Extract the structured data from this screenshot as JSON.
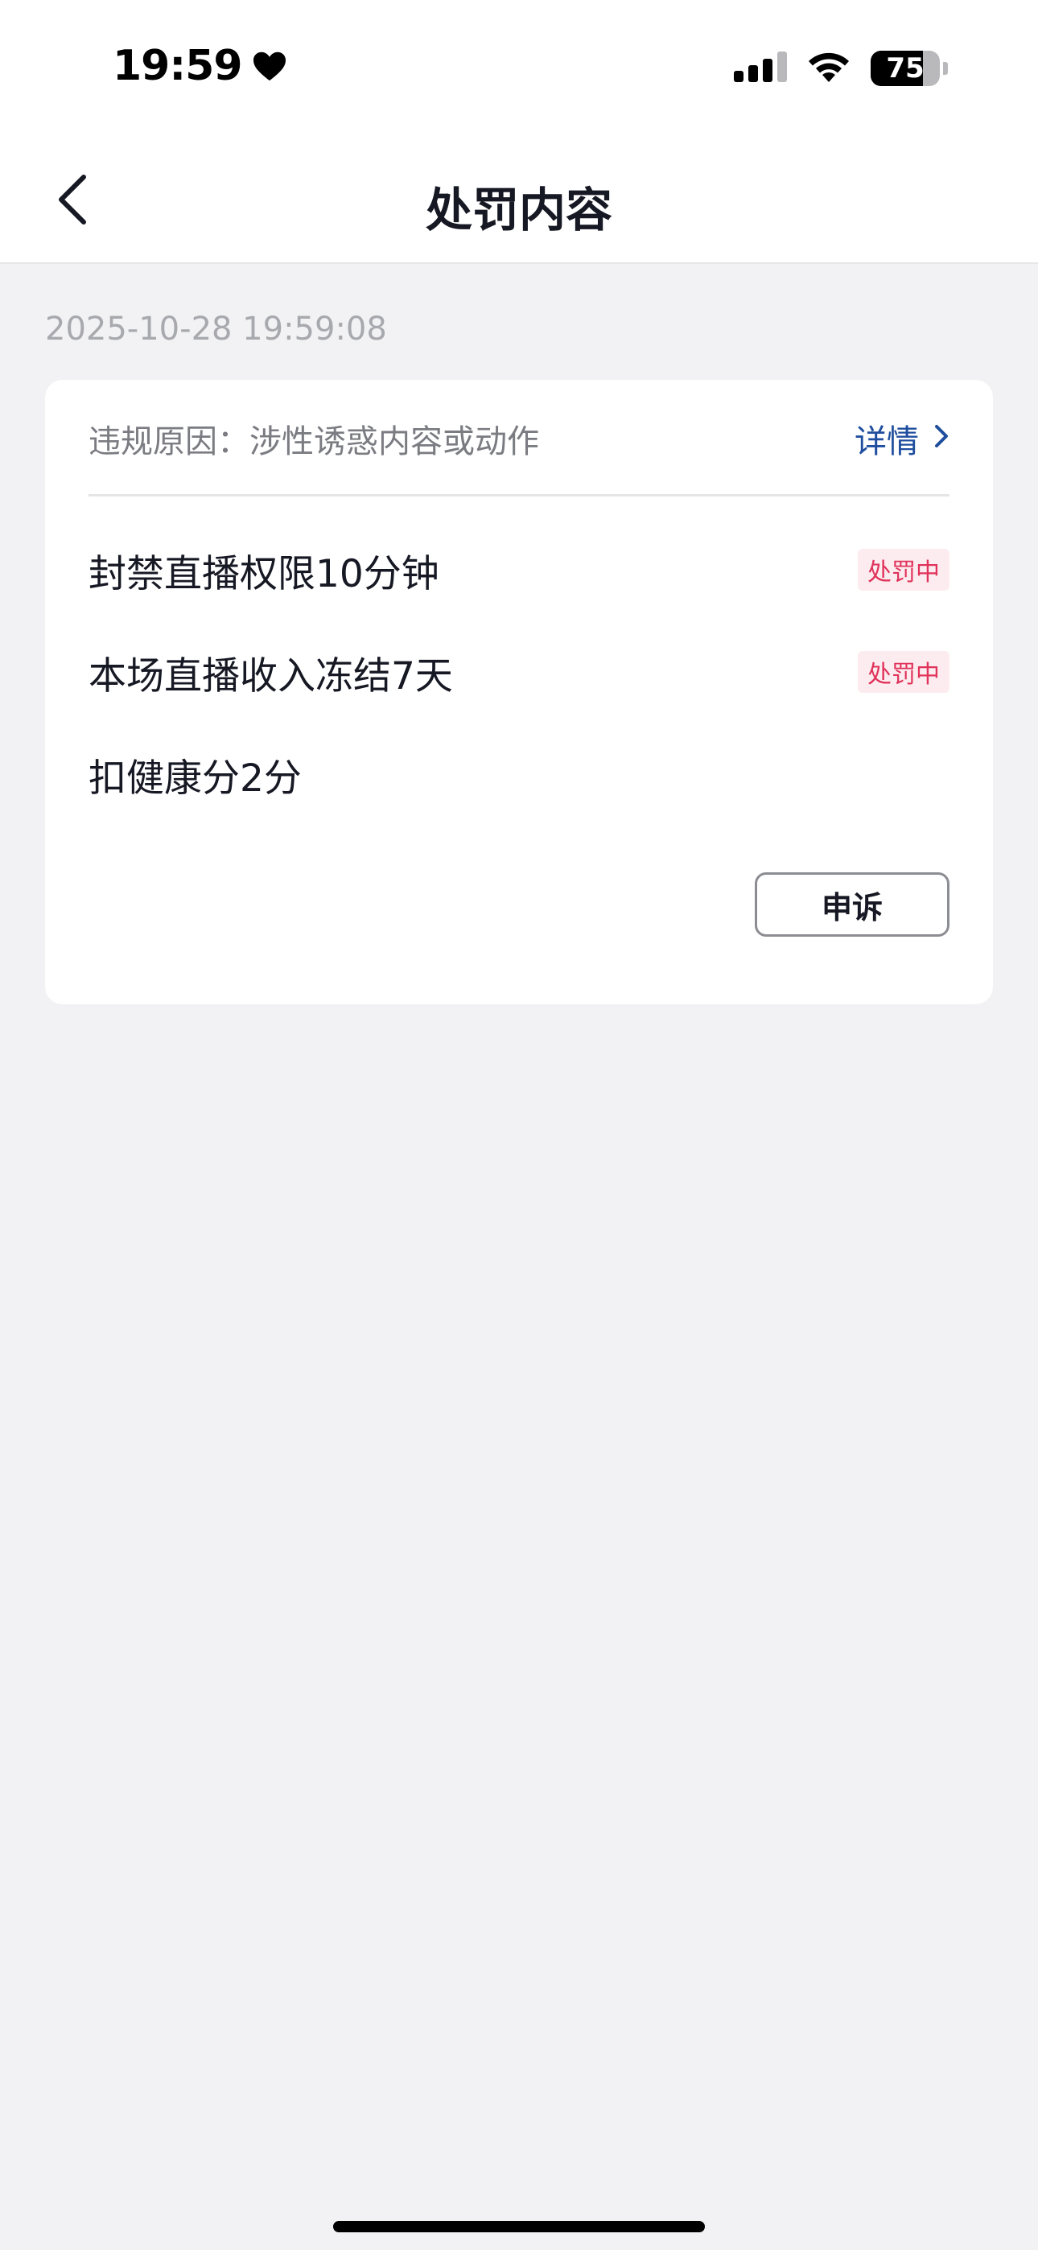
{
  "status_bar": {
    "time": "19:59",
    "battery_level": "75",
    "battery_fraction": 0.75
  },
  "nav": {
    "title": "处罚内容"
  },
  "record": {
    "timestamp": "2025-10-28 19:59:08",
    "reason": "违规原因：涉性诱惑内容或动作",
    "detail_label": "详情",
    "penalties": [
      {
        "text": "封禁直播权限10分钟",
        "status": "处罚中"
      },
      {
        "text": "本场直播收入冻结7天",
        "status": "处罚中"
      },
      {
        "text": "扣健康分2分",
        "status": ""
      }
    ],
    "appeal_label": "申诉"
  },
  "colors": {
    "accent_link": "#1f4e9e",
    "badge_text": "#e0325a",
    "badge_bg": "#fcecef",
    "page_bg": "#f2f2f4"
  },
  "icons": {
    "status": [
      "heart-icon",
      "signal-icon",
      "wifi-icon",
      "battery-icon"
    ],
    "nav": [
      "back-arrow-icon"
    ],
    "detail": [
      "chevron-right-icon"
    ]
  }
}
